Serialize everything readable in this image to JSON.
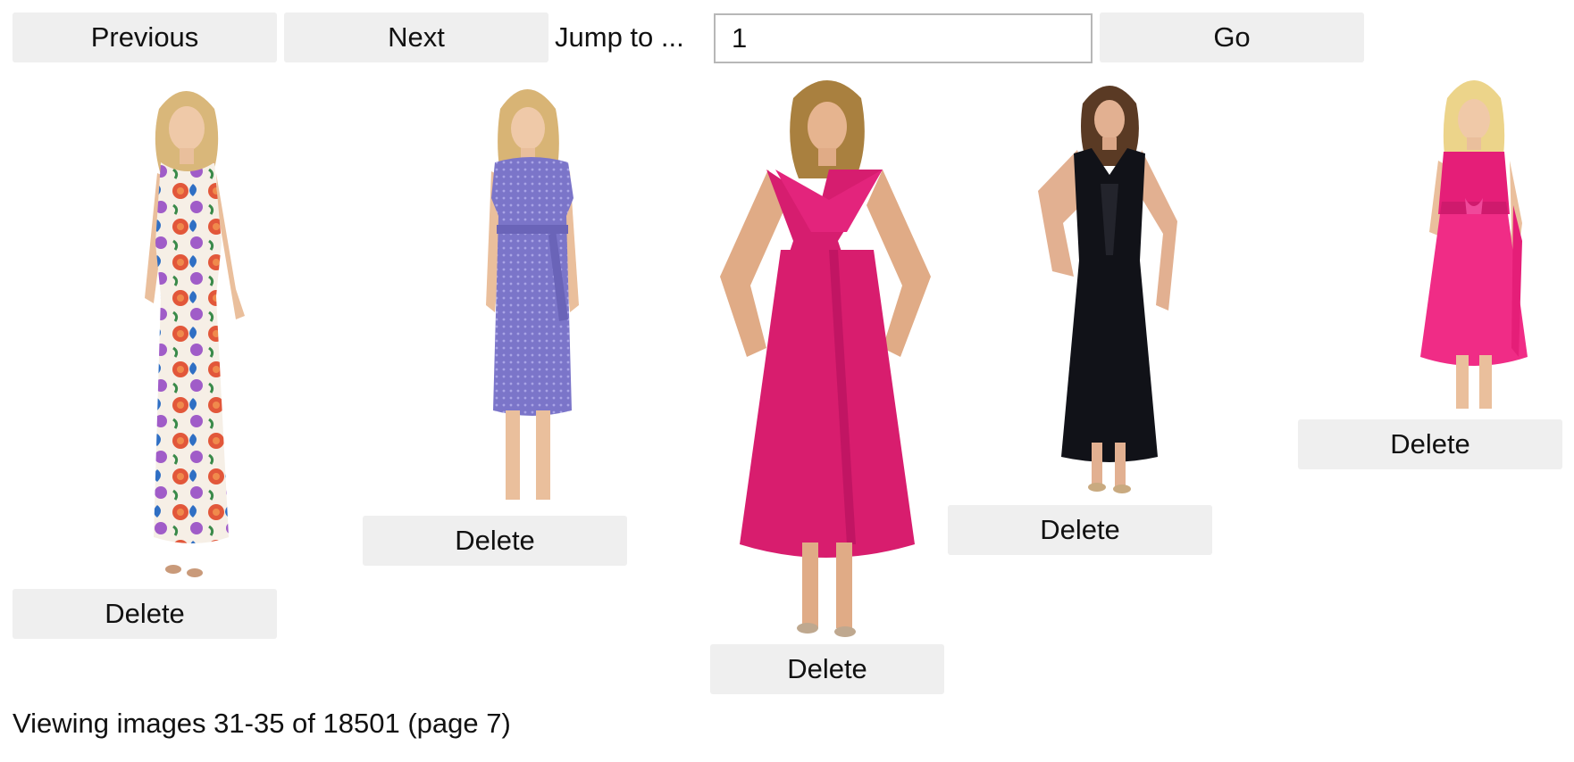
{
  "nav": {
    "previous_label": "Previous",
    "next_label": "Next",
    "jump_label": "Jump to ...",
    "jump_value": "1",
    "go_label": "Go"
  },
  "gallery": {
    "items": [
      {
        "delete_label": "Delete",
        "dress_color": "floral print"
      },
      {
        "delete_label": "Delete",
        "dress_color": "lavender purple"
      },
      {
        "delete_label": "Delete",
        "dress_color": "fuchsia pink"
      },
      {
        "delete_label": "Delete",
        "dress_color": "black"
      },
      {
        "delete_label": "Delete",
        "dress_color": "hot pink"
      }
    ]
  },
  "status": {
    "text": "Viewing images 31-35 of 18501 (page 7)"
  }
}
